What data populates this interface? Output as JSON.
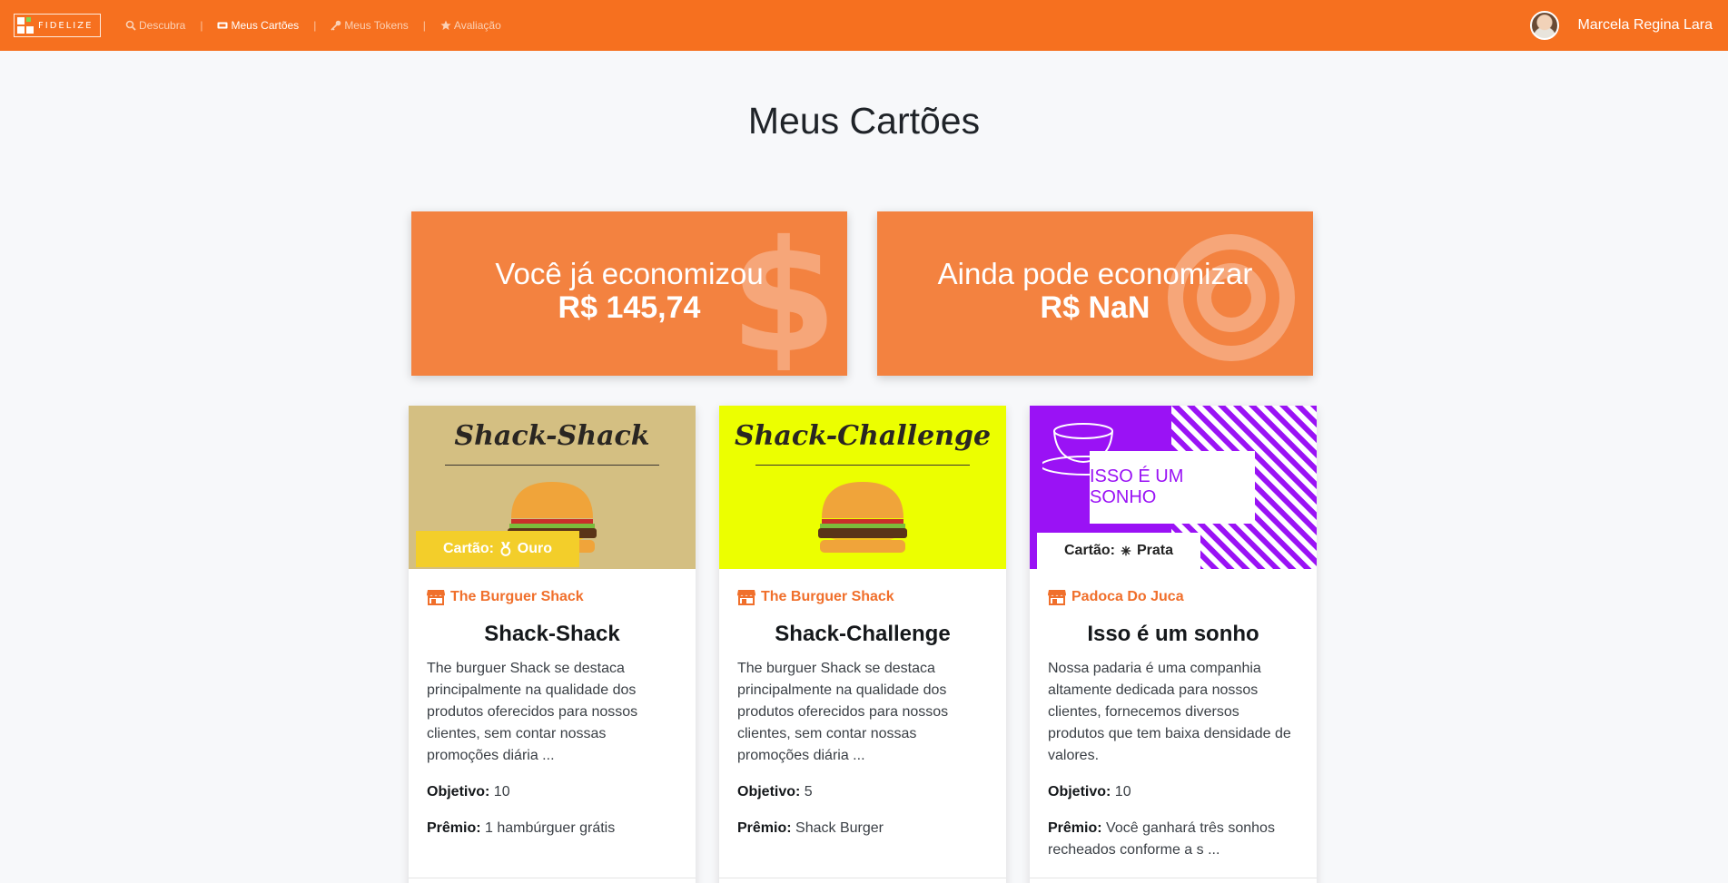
{
  "nav": {
    "brand": "FIDELIZE",
    "links": [
      {
        "label": "Descubra",
        "icon": "search-icon"
      },
      {
        "label": "Meus Cartões",
        "icon": "ticket-icon"
      },
      {
        "label": "Meus Tokens",
        "icon": "key-icon"
      },
      {
        "label": "Avaliação",
        "icon": "star-icon"
      }
    ],
    "separator": "|",
    "user_name": "Marcela Regina Lara"
  },
  "page": {
    "title": "Meus Cartões"
  },
  "stats": {
    "saved": {
      "label": "Você já economizou",
      "value": "R$ 145,74",
      "icon": "dollar-icon"
    },
    "remaining": {
      "label": "Ainda pode economizar",
      "value": "R$ NaN",
      "icon": "target-icon"
    }
  },
  "cards": [
    {
      "image_title": "Shack-Shack",
      "image_bg": "#d4bf82",
      "badge": {
        "prefix": "Cartão:",
        "icon": "medal-icon",
        "level": "Ouro"
      },
      "shop": "The Burguer Shack",
      "title": "Shack-Shack",
      "description": "The burguer Shack se destaca principalmente na qualidade dos produtos oferecidos para nossos clientes, sem contar nossas promoções diária ...",
      "goal_label": "Objetivo:",
      "goal": "10",
      "prize_label": "Prêmio:",
      "prize": "1 hambúrguer grátis"
    },
    {
      "image_title": "Shack-Challenge",
      "image_bg": "#ecff00",
      "badge": null,
      "shop": "The Burguer Shack",
      "title": "Shack-Challenge",
      "description": "The burguer Shack se destaca principalmente na qualidade dos produtos oferecidos para nossos clientes, sem contar nossas promoções diária ...",
      "goal_label": "Objetivo:",
      "goal": "5",
      "prize_label": "Prêmio:",
      "prize": "Shack Burger"
    },
    {
      "image_title": "ISSO É UM SONHO",
      "image_bg": "#9a12f5",
      "badge": {
        "prefix": "Cartão:",
        "icon": "snowflake-icon",
        "level": "Prata"
      },
      "shop": "Padoca Do Juca",
      "title": "Isso é um sonho",
      "description": "Nossa padaria é uma companhia altamente dedicada para nossos clientes, fornecemos diversos produtos que tem baixa densidade de valores.",
      "goal_label": "Objetivo:",
      "goal": "10",
      "prize_label": "Prêmio:",
      "prize": "Você ganhará três sonhos recheados conforme a s ..."
    }
  ],
  "colors": {
    "navbar": "#f6701f",
    "stat_card": "#f38240",
    "accent": "#f06f2b",
    "gold": "#f3ce2a"
  }
}
